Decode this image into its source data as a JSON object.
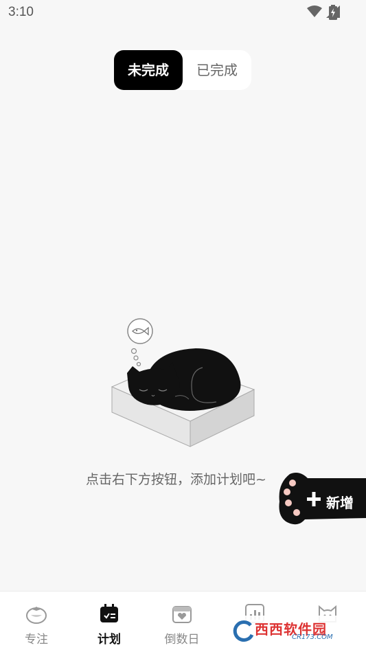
{
  "status_bar": {
    "time": "3:10"
  },
  "segment": {
    "active_label": "未完成",
    "inactive_label": "已完成"
  },
  "empty": {
    "message": "点击右下方按钮，添加计划吧~"
  },
  "fab": {
    "label": "新增"
  },
  "tabs": [
    {
      "label": "专注",
      "icon": "tomato-icon",
      "active": false
    },
    {
      "label": "计划",
      "icon": "calendar-plan-icon",
      "active": true
    },
    {
      "label": "倒数日",
      "icon": "calendar-heart-icon",
      "active": false
    },
    {
      "label": "",
      "icon": "bar-chart-icon",
      "active": false
    },
    {
      "label": "",
      "icon": "cat-icon",
      "active": false
    }
  ],
  "watermark": {
    "text": "西西软件园",
    "sub": "CR173.COM"
  },
  "colors": {
    "active": "#000000",
    "background": "#f7f7f7",
    "paw_pad": "#f6c9c2"
  }
}
